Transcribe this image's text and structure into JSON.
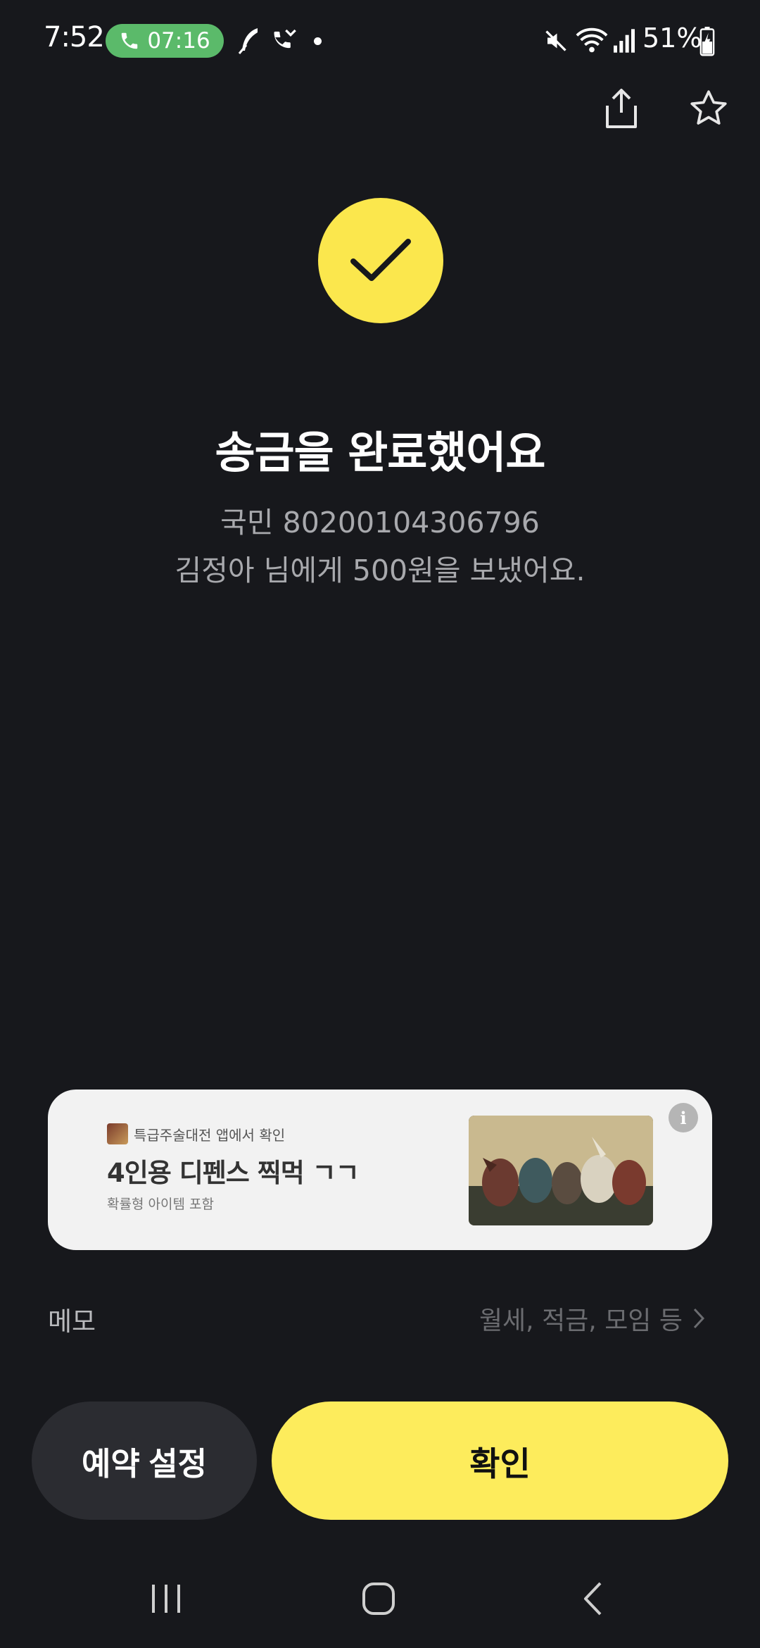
{
  "status_bar": {
    "time": "7:52",
    "call_timer": "07:16",
    "battery": "51%",
    "icons": [
      "call-icon",
      "feather-icon",
      "missed-call-icon",
      "notification-dot",
      "mute-icon",
      "wifi-icon",
      "signal-icon",
      "battery-icon"
    ]
  },
  "toolbar": {
    "share_icon": "share-icon",
    "favorite_icon": "star-icon"
  },
  "result": {
    "icon": "check-icon",
    "title": "송금을 완료했어요",
    "account": "국민 80200104306796",
    "message": "김정아 님에게 500원을 보냈어요."
  },
  "ad": {
    "source": "특급주술대전 앱에서 확인",
    "headline": "4인용 디펜스 찍먹 ㄱㄱ",
    "disclaimer": "확률형 아이템 포함",
    "info_icon": "i"
  },
  "memo": {
    "label": "메모",
    "placeholder": "월세, 적금, 모임 등"
  },
  "buttons": {
    "reserve": "예약 설정",
    "confirm": "확인"
  },
  "colors": {
    "background": "#17181c",
    "accent_yellow": "#fdec5c",
    "secondary_button": "#2b2c31",
    "call_pill": "#5bba6a"
  },
  "nav": {
    "recents": "recents-icon",
    "home": "home-icon",
    "back": "back-icon"
  }
}
